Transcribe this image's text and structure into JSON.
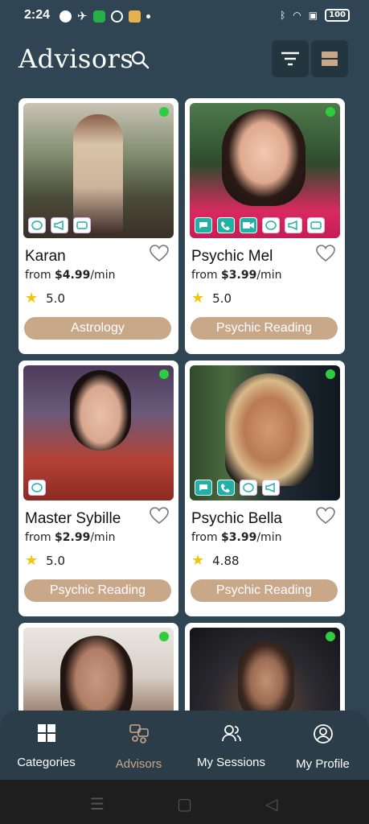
{
  "status_bar": {
    "time": "2:24",
    "battery": "100"
  },
  "header": {
    "title": "Advisors",
    "search_icon": "search-icon",
    "filter_icon": "filter-icon",
    "layout_icon": "layout-toggle-icon"
  },
  "advisors": [
    {
      "name": "Karan",
      "price_prefix": "from",
      "price": "$4.99",
      "per": "/min",
      "rating": "5.0",
      "category": "Astrology",
      "online": true,
      "services": [
        "chat-bubble-icon",
        "megaphone-icon",
        "video-icon"
      ]
    },
    {
      "name": "Psychic Mel",
      "price_prefix": "from",
      "price": "$3.99",
      "per": "/min",
      "rating": "5.0",
      "category": "Psychic Reading",
      "online": true,
      "services": [
        "chat-icon",
        "phone-icon",
        "video-icon",
        "chat-bubble-icon",
        "megaphone-icon",
        "video-icon"
      ]
    },
    {
      "name": "Master Sybille",
      "price_prefix": "from",
      "price": "$2.99",
      "per": "/min",
      "rating": "5.0",
      "category": "Psychic Reading",
      "online": true,
      "services": [
        "chat-bubble-icon"
      ]
    },
    {
      "name": "Psychic Bella",
      "price_prefix": "from",
      "price": "$3.99",
      "per": "/min",
      "rating": "4.88",
      "category": "Psychic Reading",
      "online": true,
      "services": [
        "chat-icon",
        "phone-icon",
        "chat-bubble-icon",
        "megaphone-icon"
      ]
    }
  ],
  "nav": {
    "items": [
      {
        "label": "Categories",
        "icon": "grid-icon"
      },
      {
        "label": "Advisors",
        "icon": "advisors-icon"
      },
      {
        "label": "My Sessions",
        "icon": "sessions-icon"
      },
      {
        "label": "My Profile",
        "icon": "profile-icon"
      }
    ]
  },
  "colors": {
    "background": "#2f4553",
    "accent": "#c9a88a",
    "online": "#2ecc40",
    "service_teal": "#1fb3a8"
  }
}
